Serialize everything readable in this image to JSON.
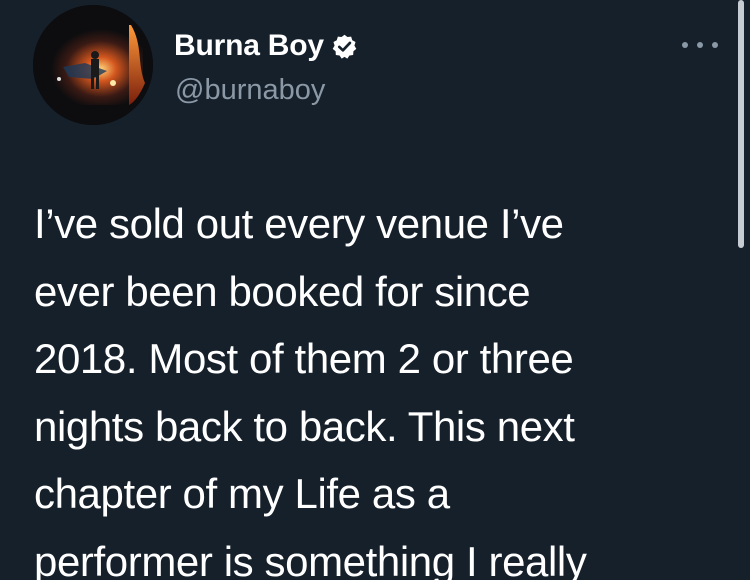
{
  "tweet": {
    "author": {
      "display_name": "Burna Boy",
      "handle": "@burnaboy",
      "verified": true,
      "verified_icon": "verified-badge-icon",
      "avatar_icon": "profile-photo"
    },
    "more_icon": "more-options-icon",
    "text": "I’ve sold out every venue I’ve\never been booked for since\n2018. Most of them 2 or three\nnights back to back. This next\nchapter of my Life as a\nperformer is something I really"
  },
  "colors": {
    "background": "#15202b",
    "text_primary": "#ffffff",
    "text_secondary": "#8b98a5",
    "verified_badge": "#ffffff"
  }
}
